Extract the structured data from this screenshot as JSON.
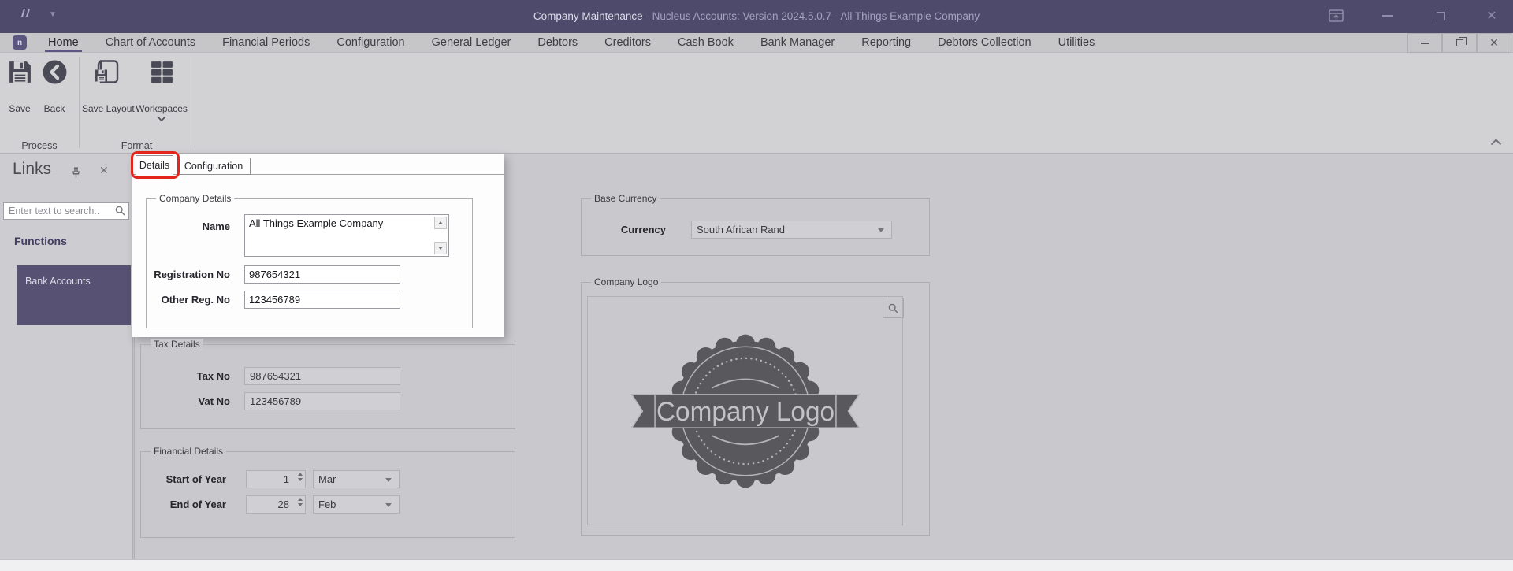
{
  "colors": {
    "titlebar_bg": "#4d4a6b",
    "accent_purple": "#5b5680",
    "selected_tile_bg": "#575273",
    "annotation_red": "#e3261b",
    "ribbon_bg": "#d2d1d4",
    "content_bg": "#c9c8cc",
    "icon_dark": "#4a4956"
  },
  "title_bar": {
    "title_primary": "Company Maintenance",
    "title_secondary": " - Nucleus Accounts: Version 2024.5.0.7 - All Things Example Company"
  },
  "ribbon": {
    "tabs": [
      {
        "label": "Home",
        "active": true
      },
      {
        "label": "Chart of Accounts"
      },
      {
        "label": "Financial Periods"
      },
      {
        "label": "Configuration"
      },
      {
        "label": "General Ledger"
      },
      {
        "label": "Debtors"
      },
      {
        "label": "Creditors"
      },
      {
        "label": "Cash Book"
      },
      {
        "label": "Bank Manager"
      },
      {
        "label": "Reporting"
      },
      {
        "label": "Debtors Collection"
      },
      {
        "label": "Utilities"
      }
    ],
    "buttons": {
      "save": "Save",
      "back": "Back",
      "save_layout": "Save Layout",
      "workspaces": "Workspaces"
    },
    "groups": {
      "process": "Process",
      "format": "Format"
    }
  },
  "links_panel": {
    "title": "Links",
    "search_placeholder": "Enter text to search..",
    "section_title": "Functions",
    "items": [
      {
        "label": "Bank Accounts",
        "selected": true
      }
    ]
  },
  "main": {
    "tabs": [
      {
        "label": "Details",
        "active": true,
        "annotated": true
      },
      {
        "label": "Configuration"
      }
    ],
    "company_details": {
      "legend": "Company Details",
      "name_label": "Name",
      "name_value": "All Things Example Company",
      "registration_label": "Registration No",
      "registration_value": "987654321",
      "other_reg_label": "Other Reg. No",
      "other_reg_value": "123456789"
    },
    "tax_details": {
      "legend": "Tax Details",
      "tax_no_label": "Tax No",
      "tax_no_value": "987654321",
      "vat_no_label": "Vat No",
      "vat_no_value": "123456789"
    },
    "financial_details": {
      "legend": "Financial Details",
      "start_label": "Start of Year",
      "start_day": "1",
      "start_month": "Mar",
      "end_label": "End of Year",
      "end_day": "28",
      "end_month": "Feb"
    },
    "base_currency": {
      "legend": "Base Currency",
      "currency_label": "Currency",
      "currency_value": "South African Rand"
    },
    "company_logo": {
      "legend": "Company Logo",
      "badge_text": "Company Logo"
    }
  }
}
